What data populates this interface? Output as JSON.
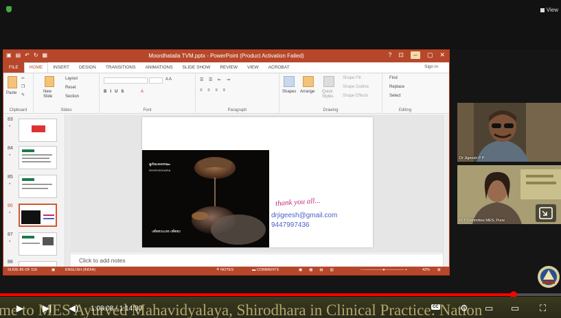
{
  "topbar": {
    "view_label": "View"
  },
  "ppt": {
    "title": "Moordhataila TVM.pptx - PowerPoint (Product Activation Failed)",
    "help": "?",
    "tabs": [
      {
        "label": "FILE"
      },
      {
        "label": "HOME"
      },
      {
        "label": "INSERT"
      },
      {
        "label": "DESIGN"
      },
      {
        "label": "TRANSITIONS"
      },
      {
        "label": "ANIMATIONS"
      },
      {
        "label": "SLIDE SHOW"
      },
      {
        "label": "REVIEW"
      },
      {
        "label": "VIEW"
      },
      {
        "label": "ACROBAT"
      }
    ],
    "sign_in": "Sign in",
    "ribbon": {
      "paste": "Paste",
      "new_slide": "New Slide",
      "layout": "Layout",
      "reset": "Reset",
      "section": "Section",
      "font_size": "A A",
      "shapes": "Shapes",
      "arrange": "Arrange",
      "quick_styles": "Quick Styles",
      "shape_fill": "Shape Fill",
      "shape_outline": "Shape Outline",
      "shape_effects": "Shape Effects",
      "find": "Find",
      "replace": "Replace",
      "select": "Select",
      "groups": {
        "clipboard": "Clipboard",
        "slides": "Slides",
        "font": "Font",
        "paragraph": "Paragraph",
        "drawing": "Drawing",
        "editing": "Editing"
      }
    },
    "thumbnails": [
      {
        "num": "83",
        "star": "*"
      },
      {
        "num": "84",
        "star": "*"
      },
      {
        "num": "85",
        "star": "*"
      },
      {
        "num": "86",
        "star": "*"
      },
      {
        "num": "87",
        "star": "*"
      },
      {
        "num": "88",
        "star": ""
      }
    ],
    "slide": {
      "caption_top": "മൂർദ്ധതൈലം",
      "caption_top2": "SHIRODHARA",
      "caption_bottom": "ശിരോധാര ശിരോ",
      "thanks": "thank you all...",
      "email": "drjigeesh@gmail.com",
      "phone": "9447997436"
    },
    "notes_placeholder": "Click to add notes",
    "status": {
      "slide": "SLIDE 86 OF 116",
      "language": "ENGLISH (INDIA)",
      "notes": "NOTES",
      "comments": "COMMENTS",
      "zoom": "42%"
    }
  },
  "participants": [
    {
      "name": "Dr Jigeesh P P"
    },
    {
      "name": "ICT Committee MES, Pune"
    }
  ],
  "player": {
    "timecode": "1:08:08 / 1:14:30",
    "progress_fraction": 0.915,
    "title_marquee": "me to MES Ayurved Mahavidyalaya, Shirodhara in Clinical Practice: Nation",
    "cc": "CC"
  },
  "colors": {
    "ppt_accent": "#b7472a",
    "progress": "#ff0000",
    "email": "#4a5fc1",
    "thanks": "#c0287a"
  }
}
